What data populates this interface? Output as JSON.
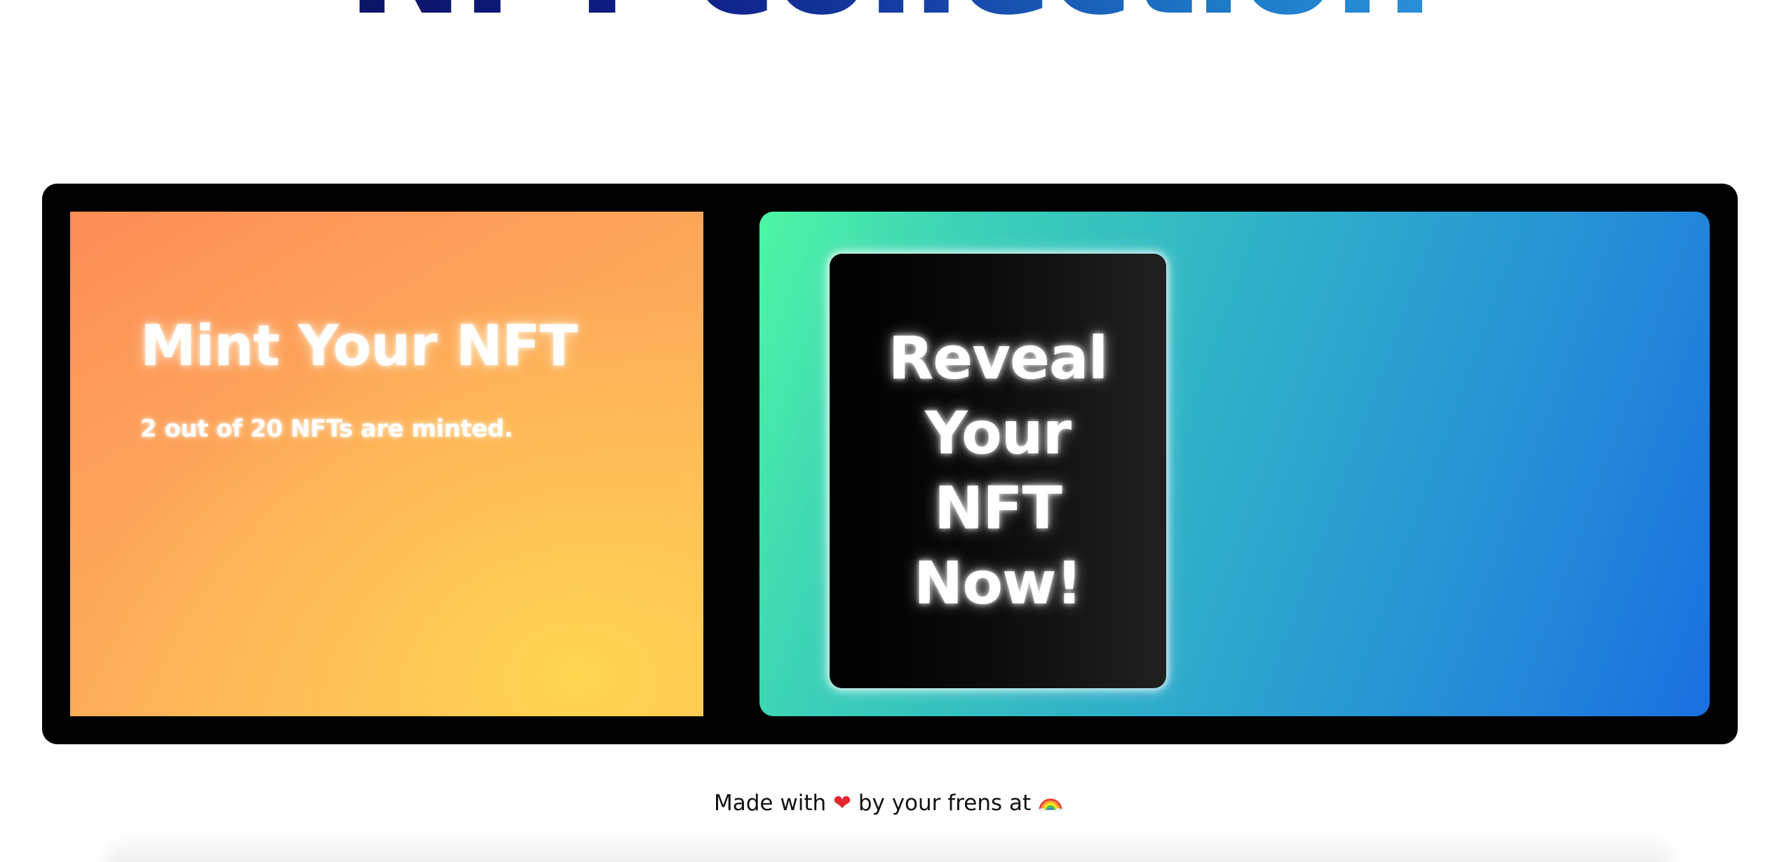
{
  "header": {
    "title": "NFT collection"
  },
  "mint": {
    "title": "Mint Your NFT",
    "status": "2 out of 20 NFTs are minted.",
    "minted_count": 2,
    "total_supply": 20
  },
  "reveal": {
    "button_label": "Reveal Your NFT Now!"
  },
  "footer": {
    "text_before": "Made with ",
    "heart": "❤",
    "text_middle": " by your frens at ",
    "rainbow_icon": "rainbow-icon"
  },
  "colors": {
    "title_gradient": [
      "#0c1464",
      "#2a90d8"
    ],
    "mint_gradient": [
      "#fd8d58",
      "#ffd551"
    ],
    "reveal_gradient": [
      "#4ef6a4",
      "#1a6fe0"
    ],
    "frame": "#000000",
    "heart": "#e3262f"
  }
}
